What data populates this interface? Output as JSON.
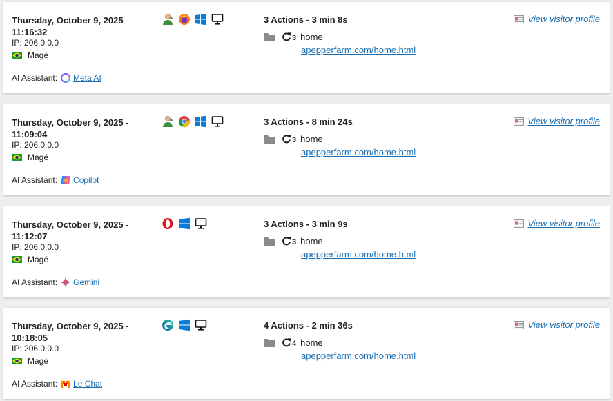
{
  "ip_label": "IP:",
  "ai_label": "AI Assistant:",
  "visits": [
    {
      "date": "Thursday, October 9, 2025",
      "dash": "-",
      "time": "11:16:32",
      "ip": "206.0.0.0",
      "city": "Magé",
      "assistant": "Meta AI",
      "assistant_icon": "meta-ai-icon",
      "browser_icon": "firefox-icon",
      "actions_summary": "3 Actions - 3 min 8s",
      "page_count": "3",
      "page_title": "home",
      "page_url": "apepperfarm.com/home.html",
      "profile_link": "View visitor profile"
    },
    {
      "date": "Thursday, October 9, 2025",
      "dash": "-",
      "time": "11:09:04",
      "ip": "206.0.0.0",
      "city": "Magé",
      "assistant": "Copilot",
      "assistant_icon": "copilot-icon",
      "browser_icon": "chrome-icon",
      "actions_summary": "3 Actions - 8 min 24s",
      "page_count": "3",
      "page_title": "home",
      "page_url": "apepperfarm.com/home.html",
      "profile_link": "View visitor profile"
    },
    {
      "date": "Thursday, October 9, 2025",
      "dash": "-",
      "time": "11:12:07",
      "ip": "206.0.0.0",
      "city": "Magé",
      "assistant": "Gemini",
      "assistant_icon": "gemini-icon",
      "browser_icon": "opera-icon",
      "actions_summary": "3 Actions - 3 min 9s",
      "page_count": "3",
      "page_title": "home",
      "page_url": "apepperfarm.com/home.html",
      "profile_link": "View visitor profile"
    },
    {
      "date": "Thursday, October 9, 2025",
      "dash": "-",
      "time": "10:18:05",
      "ip": "206.0.0.0",
      "city": "Magé",
      "assistant": "Le Chat",
      "assistant_icon": "le-chat-icon",
      "browser_icon": "edge-icon",
      "actions_summary": "4 Actions - 2 min 36s",
      "page_count": "4",
      "page_title": "home",
      "page_url": "apepperfarm.com/home.html",
      "profile_link": "View visitor profile"
    }
  ]
}
